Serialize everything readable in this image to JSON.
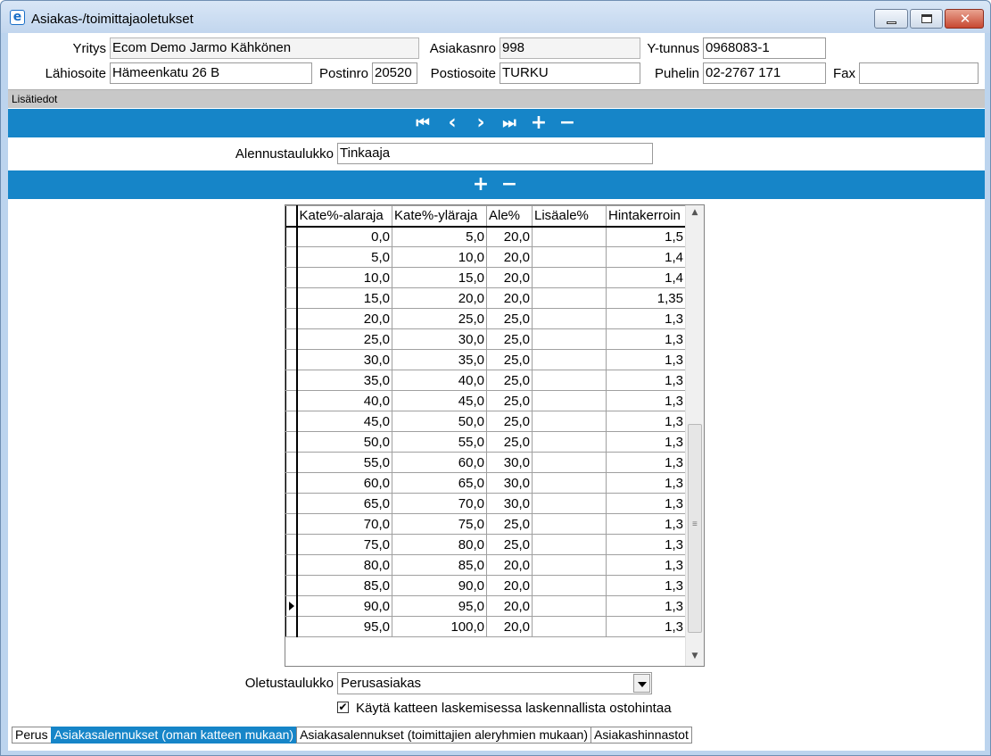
{
  "window": {
    "title": "Asiakas-/toimittajaoletukset",
    "close_glyph": "✕"
  },
  "header": {
    "yritys_label": "Yritys",
    "yritys_value": "Ecom Demo Jarmo Kähkönen",
    "asiakasnro_label": "Asiakasnro",
    "asiakasnro_value": "998",
    "ytunnus_label": "Y-tunnus",
    "ytunnus_value": "0968083-1",
    "lahiosoite_label": "Lähiosoite",
    "lahiosoite_value": "Hämeenkatu 26 B",
    "postinro_label": "Postinro",
    "postinro_value": "20520",
    "postiosoite_label": "Postiosoite",
    "postiosoite_value": "TURKU",
    "puhelin_label": "Puhelin",
    "puhelin_value": "02-2767 171",
    "fax_label": "Fax",
    "fax_value": ""
  },
  "section_label": "Lisätiedot",
  "nav": {
    "first": "⏮",
    "prev": "‹",
    "next": "›",
    "last": "⏭",
    "add": "+",
    "remove": "−"
  },
  "discount_table": {
    "label": "Alennustaulukko",
    "value": "Tinkaaja"
  },
  "grid": {
    "columns": [
      "Kate%-alaraja",
      "Kate%-yläraja",
      "Ale%",
      "Lisäale%",
      "Hintakerroin"
    ],
    "rows": [
      [
        "0,0",
        "5,0",
        "20,0",
        "",
        "1,5"
      ],
      [
        "5,0",
        "10,0",
        "20,0",
        "",
        "1,4"
      ],
      [
        "10,0",
        "15,0",
        "20,0",
        "",
        "1,4"
      ],
      [
        "15,0",
        "20,0",
        "20,0",
        "",
        "1,35"
      ],
      [
        "20,0",
        "25,0",
        "25,0",
        "",
        "1,3"
      ],
      [
        "25,0",
        "30,0",
        "25,0",
        "",
        "1,3"
      ],
      [
        "30,0",
        "35,0",
        "25,0",
        "",
        "1,3"
      ],
      [
        "35,0",
        "40,0",
        "25,0",
        "",
        "1,3"
      ],
      [
        "40,0",
        "45,0",
        "25,0",
        "",
        "1,3"
      ],
      [
        "45,0",
        "50,0",
        "25,0",
        "",
        "1,3"
      ],
      [
        "50,0",
        "55,0",
        "25,0",
        "",
        "1,3"
      ],
      [
        "55,0",
        "60,0",
        "30,0",
        "",
        "1,3"
      ],
      [
        "60,0",
        "65,0",
        "30,0",
        "",
        "1,3"
      ],
      [
        "65,0",
        "70,0",
        "30,0",
        "",
        "1,3"
      ],
      [
        "70,0",
        "75,0",
        "25,0",
        "",
        "1,3"
      ],
      [
        "75,0",
        "80,0",
        "25,0",
        "",
        "1,3"
      ],
      [
        "80,0",
        "85,0",
        "20,0",
        "",
        "1,3"
      ],
      [
        "85,0",
        "90,0",
        "20,0",
        "",
        "1,3"
      ],
      [
        "90,0",
        "95,0",
        "20,0",
        "",
        "1,3"
      ],
      [
        "95,0",
        "100,0",
        "20,0",
        "",
        "1,3"
      ]
    ],
    "current_row": 18,
    "scroll_up": "▲",
    "scroll_down": "▼",
    "scroll_grip": "≡"
  },
  "default_table": {
    "label": "Oletustaulukko",
    "value": "Perusasiakas"
  },
  "checkbox": {
    "label": "Käytä katteen laskemisessa laskennallista ostohintaa",
    "checked": true,
    "mark": "✔"
  },
  "tabs": [
    {
      "label": "Perus",
      "active": false
    },
    {
      "label": "Asiakasalennukset (oman katteen mukaan)",
      "active": true
    },
    {
      "label": "Asiakasalennukset (toimittajien aleryhmien mukaan)",
      "active": false
    },
    {
      "label": "Asiakashinnastot",
      "active": false
    }
  ]
}
